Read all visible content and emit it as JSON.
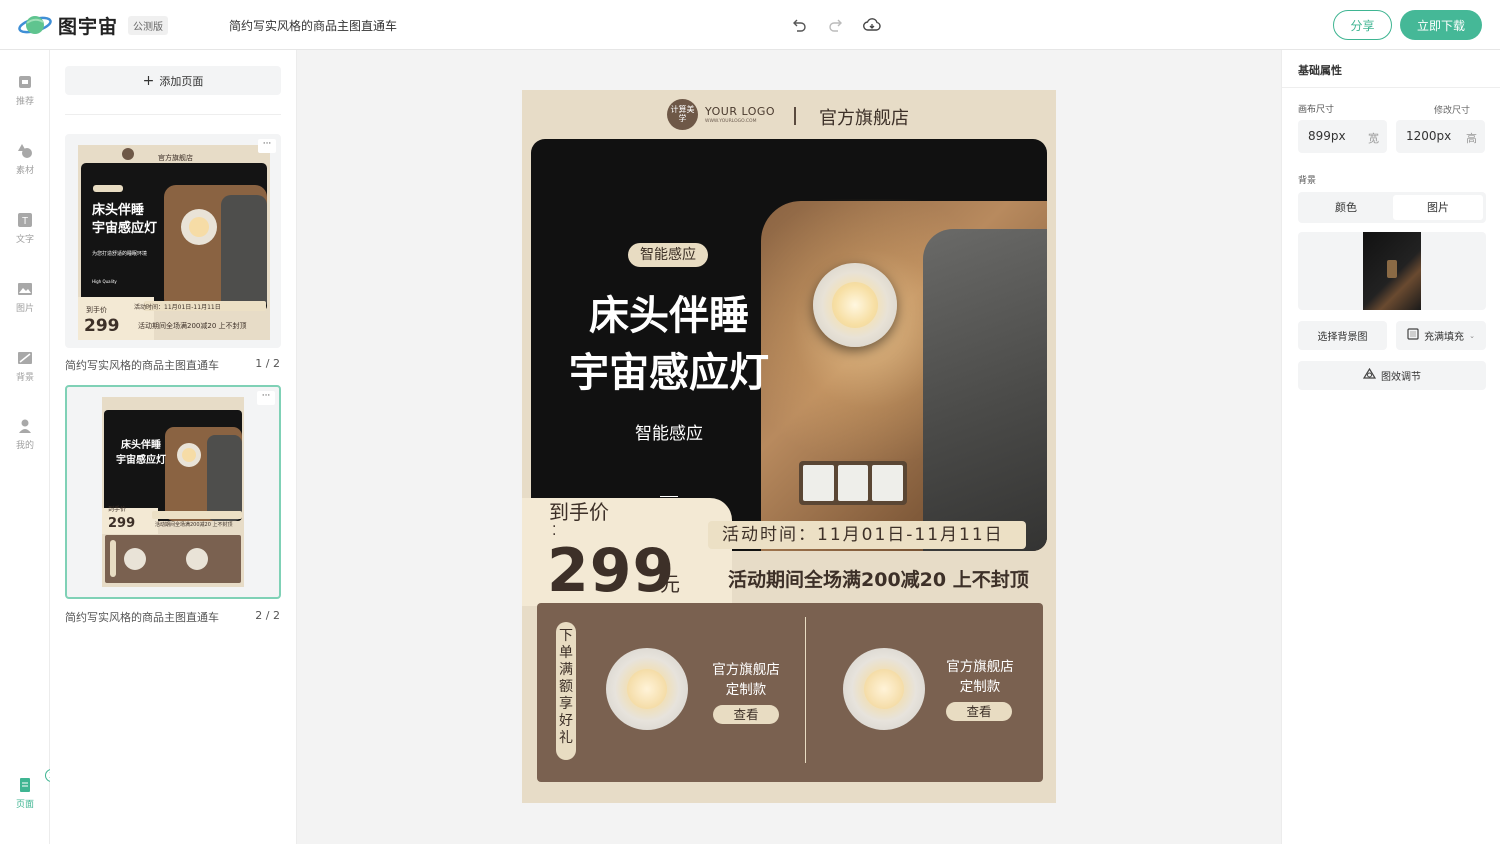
{
  "topbar": {
    "app_name": "图宇宙",
    "beta_badge": "公测版",
    "doc_title": "简约写实风格的商品主图直通车",
    "share_label": "分享",
    "download_label": "立即下载",
    "icons": [
      "undo-icon",
      "redo-icon",
      "cloud-save-icon"
    ],
    "accent_color": "#45b897"
  },
  "nav": {
    "items": [
      {
        "label": "推荐",
        "icon": "recommend-icon"
      },
      {
        "label": "素材",
        "icon": "shapes-icon"
      },
      {
        "label": "文字",
        "icon": "text-icon"
      },
      {
        "label": "图片",
        "icon": "image-icon"
      },
      {
        "label": "背景",
        "icon": "background-icon"
      },
      {
        "label": "我的",
        "icon": "user-icon"
      }
    ],
    "pages": {
      "label": "页面",
      "count": "2",
      "icon": "pages-icon"
    }
  },
  "pages_panel": {
    "add_page_label": "添加页面",
    "pages": [
      {
        "label": "简约写实风格的商品主图直通车",
        "number": "1 / 2"
      },
      {
        "label": "简约写实风格的商品主图直通车",
        "number": "2 / 2"
      }
    ],
    "more_label": "···"
  },
  "poster": {
    "badge_text": "计算美学",
    "logo_main": "YOUR LOGO",
    "logo_sub": "WWW.YOURLOGO.COM",
    "shop_name": "官方旗舰店",
    "tag_top": "智能感应",
    "title_line1": "床头伴睡",
    "title_line2": "宇宙感应灯",
    "subtitle": "智能感应",
    "quality": "High Quality",
    "price_label": "到手价",
    "price": "299",
    "price_unit": "元",
    "activity_time": "活动时间：11月01日-11月11日",
    "activity_note": "活动期间全场满200减20 上不封顶",
    "promo_vertical": "下单满额享好礼",
    "promo_items": [
      {
        "text1": "官方旗舰店",
        "text2": "定制款",
        "button": "查看"
      },
      {
        "text1": "官方旗舰店",
        "text2": "定制款",
        "button": "查看"
      }
    ],
    "thumb_small_note": "为您打造舒适的睡眠环境"
  },
  "properties": {
    "header": "基础属性",
    "canvas_size_label": "画布尺寸",
    "modify_size_label": "修改尺寸",
    "width_value": "899px",
    "width_unit": "宽",
    "height_value": "1200px",
    "height_unit": "高",
    "background_label": "背景",
    "bg_tab_color": "颜色",
    "bg_tab_image": "图片",
    "select_bg_label": "选择背景图",
    "fill_mode_label": "充满填充",
    "effect_label": "图效调节"
  }
}
